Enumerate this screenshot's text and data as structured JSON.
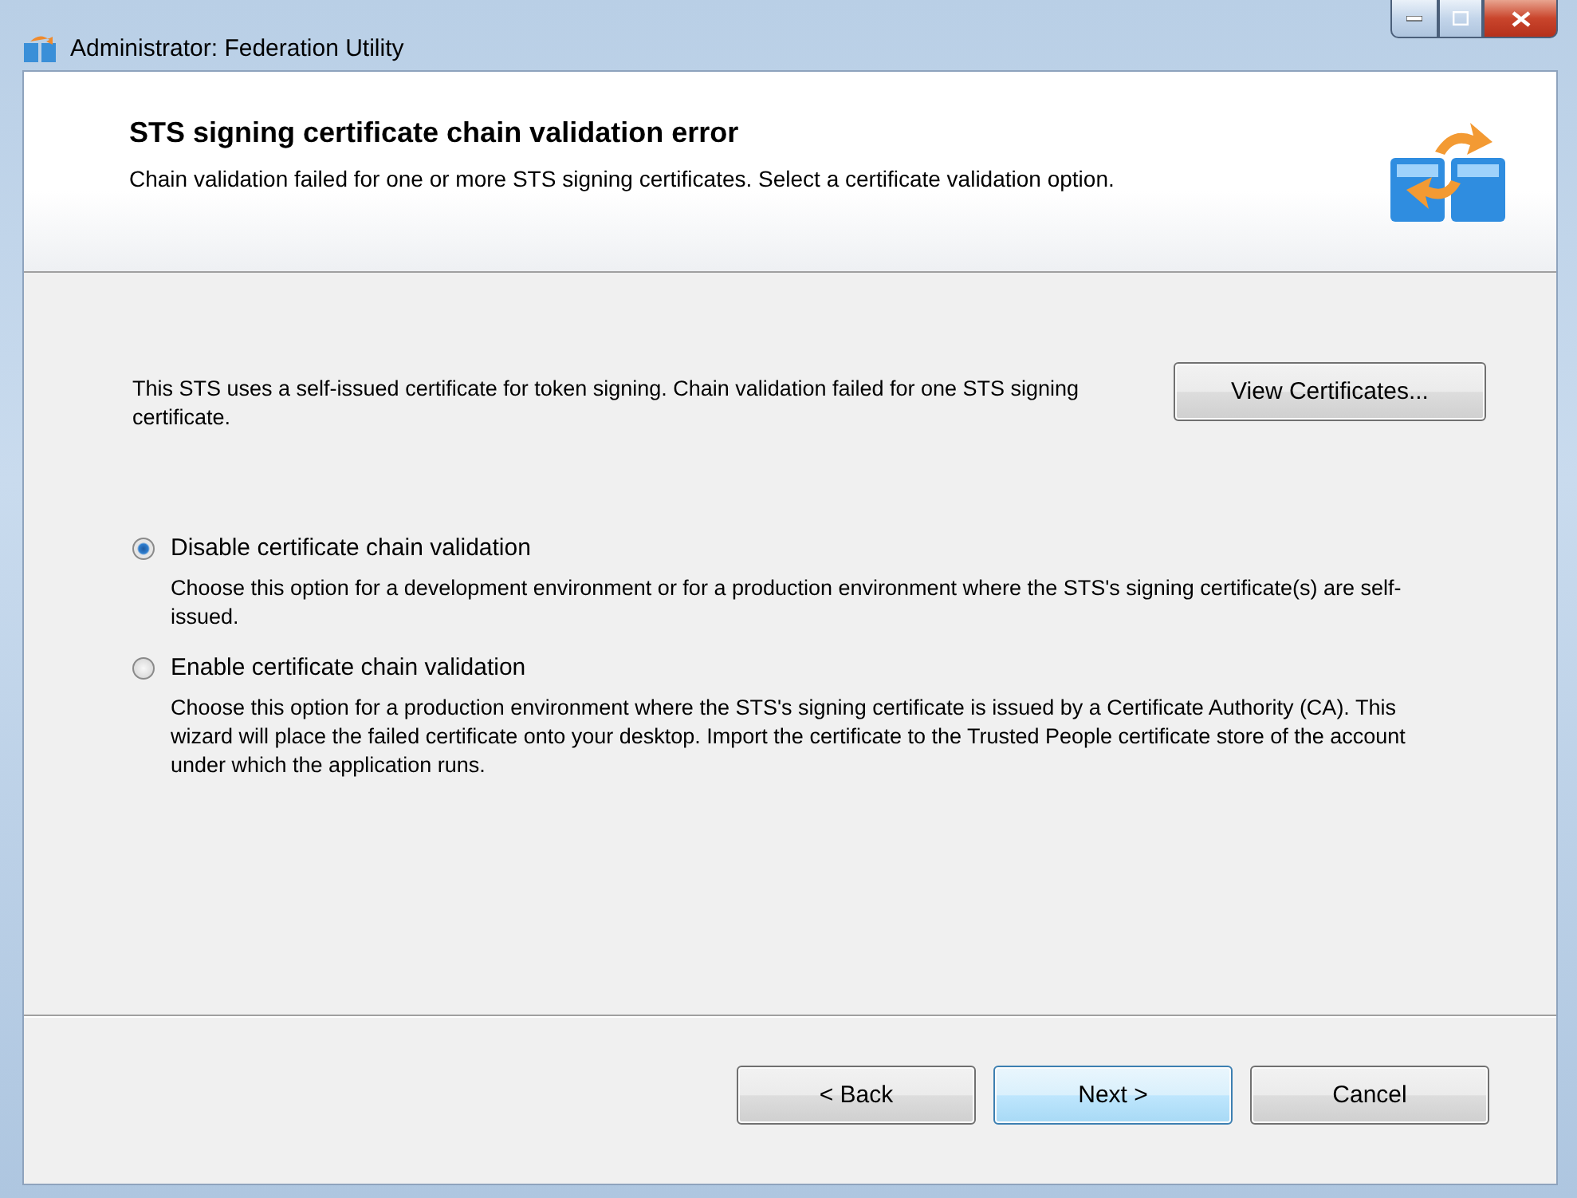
{
  "window": {
    "title": "Administrator: Federation Utility"
  },
  "header": {
    "title": "STS signing certificate chain validation error",
    "subtitle": "Chain validation failed for one or more STS signing certificates. Select a certificate validation option."
  },
  "info": {
    "text": "This STS uses a self-issued certificate for token signing. Chain validation failed for one STS signing certificate.",
    "button": "View Certificates..."
  },
  "options": [
    {
      "label": "Disable certificate chain validation",
      "selected": true,
      "description": "Choose this option for a development environment or for a production environment where the STS's signing certificate(s) are self-issued."
    },
    {
      "label": "Enable certificate chain validation",
      "selected": false,
      "description": "Choose this option for a production environment where the STS's signing certificate is issued by a Certificate Authority (CA).  This wizard will place the failed certificate onto your desktop. Import the certificate to the Trusted People certificate store of the account under which the application runs."
    }
  ],
  "buttons": [
    {
      "label": "< Back",
      "default": false
    },
    {
      "label": "Next >",
      "default": true
    },
    {
      "label": "Cancel",
      "default": false
    }
  ]
}
